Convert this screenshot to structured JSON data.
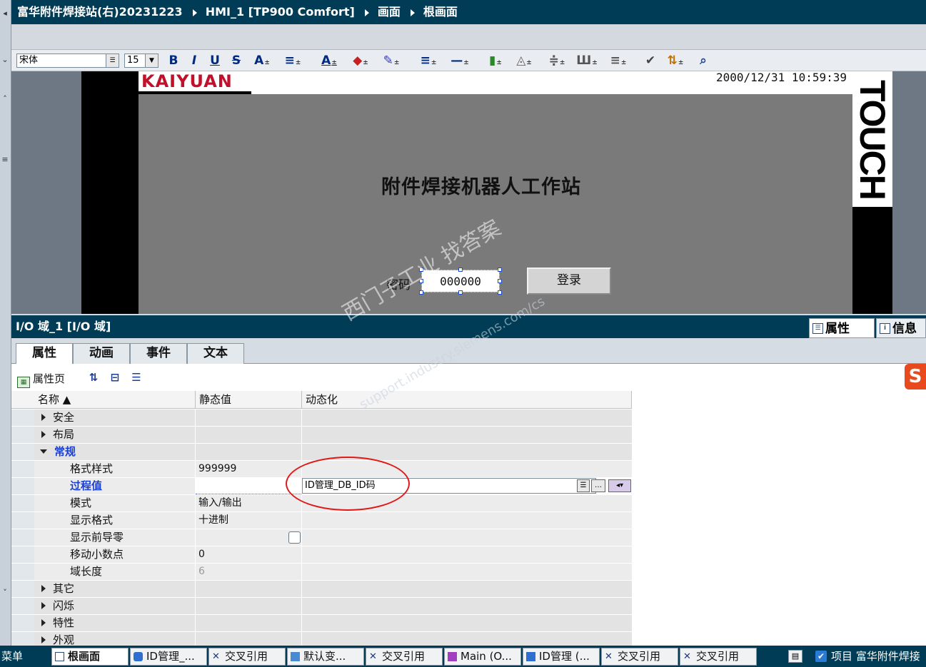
{
  "breadcrumb": [
    "富华附件焊接站(右)20231223",
    "HMI_1 [TP900 Comfort]",
    "画面",
    "根画面"
  ],
  "format_toolbar": {
    "font": "宋体",
    "size": "15",
    "buttons": [
      {
        "label": "B"
      },
      {
        "label": "I"
      },
      {
        "label": "U"
      },
      {
        "label": "S"
      },
      {
        "label": "A"
      },
      {
        "label": "≡"
      },
      {
        "label": "A"
      },
      {
        "label": "◆"
      },
      {
        "label": "✎"
      },
      {
        "label": "≡"
      },
      {
        "label": "—"
      },
      {
        "label": "▮"
      },
      {
        "label": "◬"
      },
      {
        "label": "≑"
      },
      {
        "label": "Ш"
      },
      {
        "label": "≡"
      },
      {
        "label": "✔"
      },
      {
        "label": "⇅"
      },
      {
        "label": "⌕"
      }
    ]
  },
  "hmi": {
    "logo": "KAIYUAN",
    "clock": "2000/12/31 10:59:39",
    "touch": "TOUCH",
    "title": "附件焊接机器人工作站",
    "password_label": "密码",
    "password_value": "000000",
    "login_label": "登录"
  },
  "inspector": {
    "title": "I/O 域_1 [I/O 域]",
    "right_tabs": [
      {
        "label": "属性",
        "icon": "properties-icon"
      },
      {
        "label": "信息",
        "icon": "info-icon"
      }
    ],
    "tabs": [
      "属性",
      "动画",
      "事件",
      "文本"
    ],
    "toolbar_label": "属性页",
    "columns": [
      "名称",
      "静态值",
      "动态化"
    ],
    "rows": [
      {
        "name": "安全",
        "value": "",
        "group": true,
        "expanded": false
      },
      {
        "name": "布局",
        "value": "",
        "group": true,
        "expanded": false
      },
      {
        "name": "常规",
        "value": "",
        "group": true,
        "expanded": true,
        "highlight": true
      },
      {
        "name": "格式样式",
        "value": "999999"
      },
      {
        "name": "过程值",
        "value": "",
        "highlight": true,
        "dynamic": "ID管理_DB_ID码"
      },
      {
        "name": "模式",
        "value": "输入/输出"
      },
      {
        "name": "显示格式",
        "value": "十进制"
      },
      {
        "name": "显示前导零",
        "value": "",
        "checkbox": true
      },
      {
        "name": "移动小数点",
        "value": "0"
      },
      {
        "name": "域长度",
        "value": "6",
        "disabled": true
      },
      {
        "name": "其它",
        "value": "",
        "group": true,
        "expanded": false
      },
      {
        "name": "闪烁",
        "value": "",
        "group": true,
        "expanded": false
      },
      {
        "name": "特性",
        "value": "",
        "group": true,
        "expanded": false
      },
      {
        "name": "外观",
        "value": "",
        "group": true,
        "expanded": false
      }
    ]
  },
  "watermark": {
    "line1": "西门子工业  找答案",
    "line2": "support.industry.siemens.com/cs"
  },
  "taskbar": {
    "menu": "菜单",
    "items": [
      {
        "label": "根画面",
        "icon": "screen-icon",
        "selected": true
      },
      {
        "label": "ID管理_...",
        "icon": "db-icon"
      },
      {
        "label": "交叉引用",
        "icon": "crossref-icon"
      },
      {
        "label": "默认变...",
        "icon": "tagtable-icon"
      },
      {
        "label": "交叉引用",
        "icon": "crossref-icon"
      },
      {
        "label": "Main (O...",
        "icon": "ob-icon"
      },
      {
        "label": "ID管理 (...",
        "icon": "fb-icon"
      },
      {
        "label": "交叉引用",
        "icon": "crossref-icon"
      },
      {
        "label": "交叉引用",
        "icon": "crossref-icon"
      }
    ],
    "project": "项目 富华附件焊接"
  },
  "colors": {
    "titlebar": "#003c55",
    "highlight_text": "#1a3fd0",
    "annotation_circle": "#e01818",
    "logo_red": "#c0102a"
  }
}
